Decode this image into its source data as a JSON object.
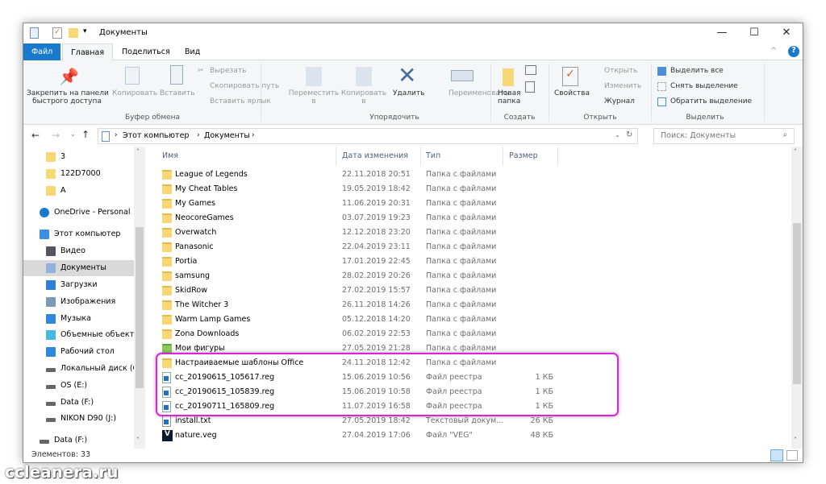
{
  "window": {
    "title": "Документы"
  },
  "tabs": [
    {
      "label": "Файл"
    },
    {
      "label": "Главная"
    },
    {
      "label": "Поделиться"
    },
    {
      "label": "Вид"
    }
  ],
  "ribbon": {
    "pin": "Закрепить на панели",
    "pin2": "быстрого доступа",
    "copy": "Копировать",
    "paste": "Вставить",
    "cut": "Вырезать",
    "copy_path": "Скопировать путь",
    "paste_shortcut": "Вставить ярлык",
    "group_clipboard": "Буфер обмена",
    "move_to": "Переместить",
    "move_to2": "в",
    "copy_to": "Копировать",
    "copy_to2": "в",
    "delete": "Удалить",
    "rename": "Переименовать",
    "group_organize": "Упорядочить",
    "new_folder": "Новая",
    "new_folder2": "папка",
    "group_new": "Создать",
    "properties": "Свойства",
    "open": "Открыть",
    "edit": "Изменить",
    "history": "Журнал",
    "group_open": "Открыть",
    "select_all": "Выделить все",
    "select_none": "Снять выделение",
    "invert": "Обратить выделение",
    "group_select": "Выделить"
  },
  "address": {
    "path": [
      "Этот компьютер",
      "Документы"
    ],
    "search_placeholder": "Поиск: Документы"
  },
  "nav": [
    {
      "label": "3",
      "icon": "folder"
    },
    {
      "label": "122D7000",
      "icon": "folder"
    },
    {
      "label": "А",
      "icon": "folder"
    },
    {
      "label": "OneDrive - Personal",
      "icon": "cloud"
    },
    {
      "label": "Этот компьютер",
      "icon": "computer"
    },
    {
      "label": "Видео",
      "icon": "video"
    },
    {
      "label": "Документы",
      "icon": "documents",
      "selected": true
    },
    {
      "label": "Загрузки",
      "icon": "download"
    },
    {
      "label": "Изображения",
      "icon": "pictures"
    },
    {
      "label": "Музыка",
      "icon": "music"
    },
    {
      "label": "Объемные объекты",
      "icon": "3d"
    },
    {
      "label": "Рабочий стол",
      "icon": "desktop"
    },
    {
      "label": "Локальный диск (C:)",
      "icon": "drive"
    },
    {
      "label": "OS (E:)",
      "icon": "drive"
    },
    {
      "label": "Data (F:)",
      "icon": "drive"
    },
    {
      "label": "NIKON D90 (J:)",
      "icon": "drive"
    },
    {
      "label": "Data (F:)",
      "icon": "drive"
    }
  ],
  "columns": {
    "name": "Имя",
    "date": "Дата изменения",
    "type": "Тип",
    "size": "Размер"
  },
  "files": [
    {
      "name": "League of Legends",
      "date": "22.11.2018 20:51",
      "type": "Папка с файлами",
      "size": "",
      "icon": "folder"
    },
    {
      "name": "My Cheat Tables",
      "date": "19.05.2019 18:42",
      "type": "Папка с файлами",
      "size": "",
      "icon": "folder"
    },
    {
      "name": "My Games",
      "date": "11.06.2019 20:31",
      "type": "Папка с файлами",
      "size": "",
      "icon": "folder"
    },
    {
      "name": "NeocoreGames",
      "date": "03.07.2019 19:23",
      "type": "Папка с файлами",
      "size": "",
      "icon": "folder"
    },
    {
      "name": "Overwatch",
      "date": "12.12.2018 23:20",
      "type": "Папка с файлами",
      "size": "",
      "icon": "folder"
    },
    {
      "name": "Panasonic",
      "date": "22.04.2019 23:11",
      "type": "Папка с файлами",
      "size": "",
      "icon": "folder"
    },
    {
      "name": "Portia",
      "date": "17.01.2019 22:45",
      "type": "Папка с файлами",
      "size": "",
      "icon": "folder"
    },
    {
      "name": "samsung",
      "date": "28.02.2019 20:26",
      "type": "Папка с файлами",
      "size": "",
      "icon": "folder"
    },
    {
      "name": "SkidRow",
      "date": "27.02.2019 15:57",
      "type": "Папка с файлами",
      "size": "",
      "icon": "folder"
    },
    {
      "name": "The Witcher 3",
      "date": "26.11.2018 14:26",
      "type": "Папка с файлами",
      "size": "",
      "icon": "folder"
    },
    {
      "name": "Warm Lamp Games",
      "date": "05.12.2018 14:20",
      "type": "Папка с файлами",
      "size": "",
      "icon": "folder"
    },
    {
      "name": "Zona Downloads",
      "date": "06.02.2019 22:53",
      "type": "Папка с файлами",
      "size": "",
      "icon": "folder"
    },
    {
      "name": "Мои фигуры",
      "date": "27.05.2019 21:28",
      "type": "Папка с файлами",
      "size": "",
      "icon": "shapes-folder"
    },
    {
      "name": "Настраиваемые шаблоны Office",
      "date": "24.11.2018 12:42",
      "type": "Папка с файлами",
      "size": "",
      "icon": "folder"
    },
    {
      "name": "cc_20190615_105617.reg",
      "date": "15.06.2019 10:56",
      "type": "Файл реестра",
      "size": "1 КБ",
      "icon": "reg"
    },
    {
      "name": "cc_20190615_105839.reg",
      "date": "15.06.2019 10:58",
      "type": "Файл реестра",
      "size": "1 КБ",
      "icon": "reg"
    },
    {
      "name": "cc_20190711_165809.reg",
      "date": "11.07.2019 16:58",
      "type": "Файл реестра",
      "size": "1 КБ",
      "icon": "reg"
    },
    {
      "name": "install.txt",
      "date": "27.05.2019 18:42",
      "type": "Текстовый докум...",
      "size": "26 КБ",
      "icon": "txt"
    },
    {
      "name": "nature.veg",
      "date": "27.04.2019 17:06",
      "type": "Файл \"VEG\"",
      "size": "48 КБ",
      "icon": "veg"
    }
  ],
  "status": {
    "count": "Элементов: 33"
  },
  "watermark": "ccleanera.ru",
  "colors": {
    "accent": "#1979ca",
    "highlight": "#e020e0"
  }
}
